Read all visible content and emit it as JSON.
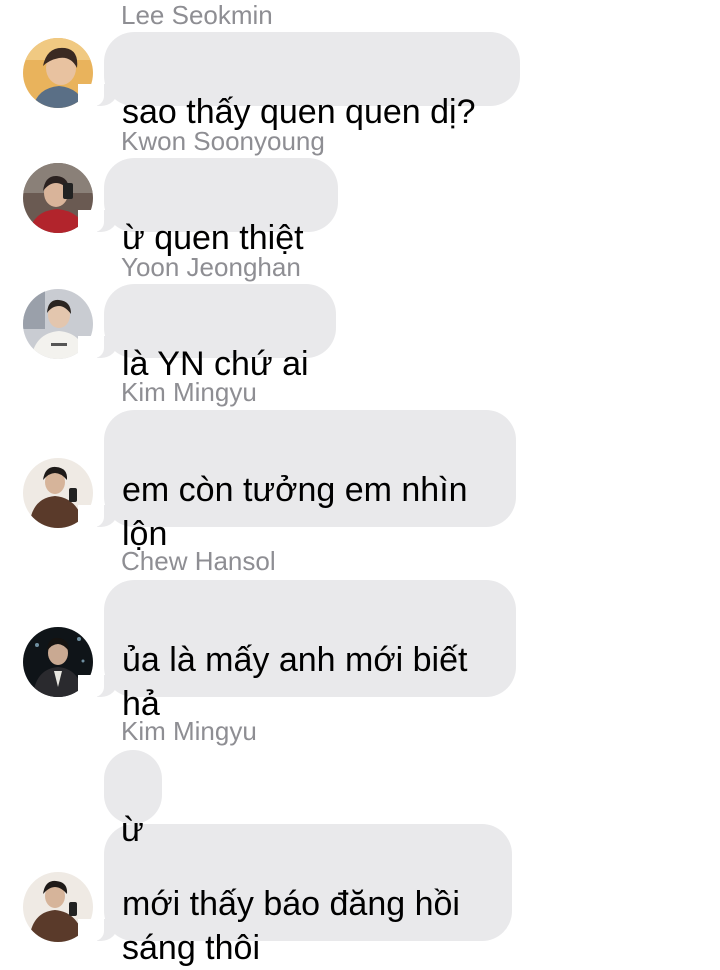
{
  "messages": [
    {
      "sender": "Lee Seokmin",
      "text": "sao thấy quen quen dị?"
    },
    {
      "sender": "Kwon Soonyoung",
      "text": "ừ quen thiệt"
    },
    {
      "sender": "Yoon Jeonghan",
      "text": "là YN chứ ai"
    },
    {
      "sender": "Kim Mingyu",
      "text": "em còn tưởng em nhìn\nlộn"
    },
    {
      "sender": "Chew Hansol",
      "text": "ủa là mấy anh mới biết\nhả"
    },
    {
      "sender": "Kim Mingyu",
      "text": "ừ"
    },
    {
      "sender": "",
      "text": "mới thấy báo đăng hồi\nsáng thôi"
    }
  ],
  "colors": {
    "bubble": "#e9e9eb",
    "sender_name": "#8e8e93",
    "text": "#000000",
    "background": "#ffffff"
  }
}
